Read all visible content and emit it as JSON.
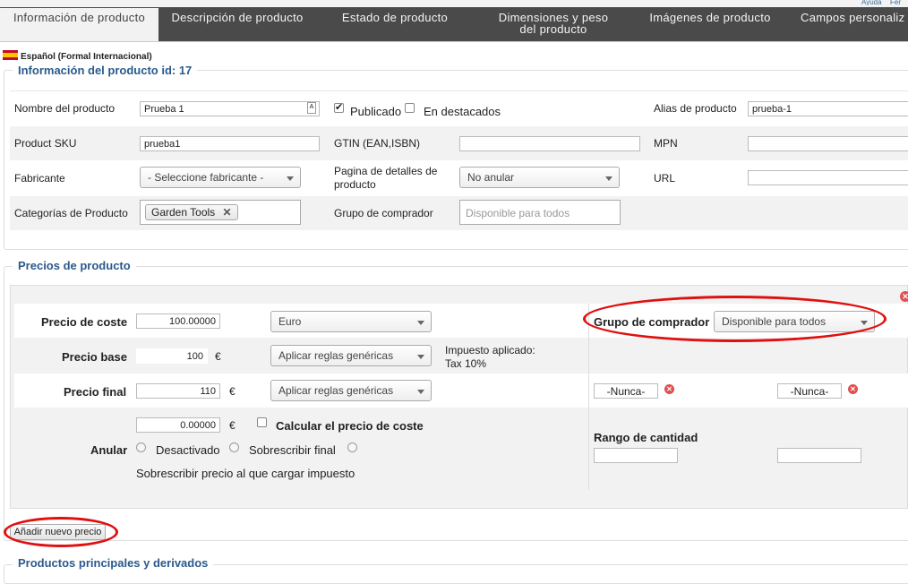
{
  "tabs": [
    {
      "label": "Información de producto"
    },
    {
      "label": "Descripción de producto"
    },
    {
      "label": "Estado de producto"
    },
    {
      "label": "Dimensiones y peso del producto"
    },
    {
      "label": "Imágenes de producto"
    },
    {
      "label": "Campos personaliz"
    }
  ],
  "top_links": {
    "help": "Ayuda",
    "more": "Fer"
  },
  "language": {
    "label": "Español (Formal Internacional)"
  },
  "info": {
    "legend": "Información del producto id: 17",
    "name_label": "Nombre del producto",
    "name_value": "Prueba 1",
    "published_label": "Publicado",
    "featured_label": "En destacados",
    "alias_label": "Alias de producto",
    "alias_value": "prueba-1",
    "sku_label": "Product SKU",
    "sku_value": "prueba1",
    "gtin_label": "GTIN (EAN,ISBN)",
    "gtin_value": "",
    "mpn_label": "MPN",
    "mpn_value": "",
    "manufacturer_label": "Fabricante",
    "manufacturer_value": "- Seleccione fabricante -",
    "details_page_label": "Pagina de detalles de producto",
    "details_page_value": "No anular",
    "url_label": "URL",
    "url_value": "",
    "categories_label": "Categorías de Producto",
    "category_tag": "Garden Tools",
    "shopper_group_label": "Grupo de comprador",
    "shopper_group_placeholder": "Disponible para todos"
  },
  "prices": {
    "legend": "Precios de producto",
    "cost_label": "Precio de coste",
    "cost_value": "100.00000",
    "currency_value": "Euro",
    "shopper_group_label": "Grupo de comprador",
    "shopper_group_value": "Disponible para todos",
    "base_label": "Precio base",
    "base_value": "100",
    "base_currency": "€",
    "base_rule": "Aplicar reglas genéricas",
    "tax_label": "Impuesto aplicado:",
    "tax_value": "Tax 10%",
    "final_label": "Precio final",
    "final_value": "110",
    "final_currency": "€",
    "final_rule": "Aplicar reglas genéricas",
    "date_from": "-Nunca-",
    "date_to": "-Nunca-",
    "override_label": "Anular",
    "override_value": "0.00000",
    "override_currency": "€",
    "calc_cost_label": "Calcular el precio de coste",
    "opt_disabled": "Desactivado",
    "opt_override_final": "Sobrescribir final",
    "opt_override_tax": "Sobrescribir precio al que cargar impuesto",
    "quantity_range_label": "Rango de cantidad",
    "qty_from": "",
    "qty_to": ""
  },
  "add_price_button": "Añadir nuevo precio",
  "next_section": {
    "legend": "Productos principales y derivados"
  },
  "colors": {
    "tabbar": "#4a4a4a",
    "legend": "#2a5a8c",
    "highlight": "#e01010"
  }
}
